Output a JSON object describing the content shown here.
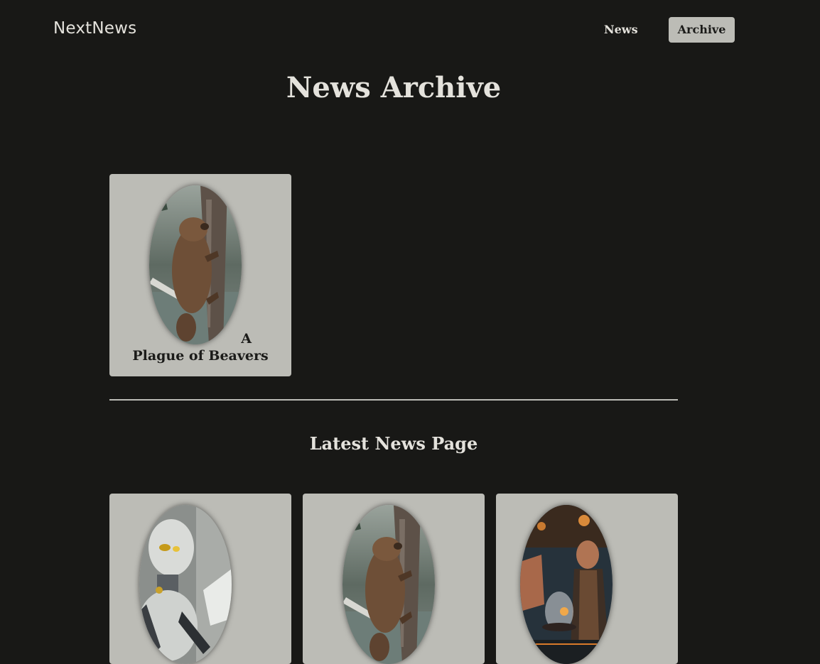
{
  "header": {
    "logo": "NextNews",
    "nav": [
      {
        "label": "News",
        "active": false
      },
      {
        "label": "Archive",
        "active": true
      }
    ]
  },
  "archive": {
    "title": "News Archive",
    "items": [
      {
        "title_line1": "A",
        "title_line2": "Plague of Beavers",
        "image": "beaver-image"
      }
    ]
  },
  "latest": {
    "title": "Latest News Page",
    "items": [
      {
        "image": "robot-image"
      },
      {
        "image": "beaver-image"
      },
      {
        "image": "chef-image"
      }
    ]
  },
  "colors": {
    "background": "#181816",
    "card": "#bcbcb6",
    "text_light": "#e4e2dc",
    "text_dark": "#1b1b19"
  }
}
